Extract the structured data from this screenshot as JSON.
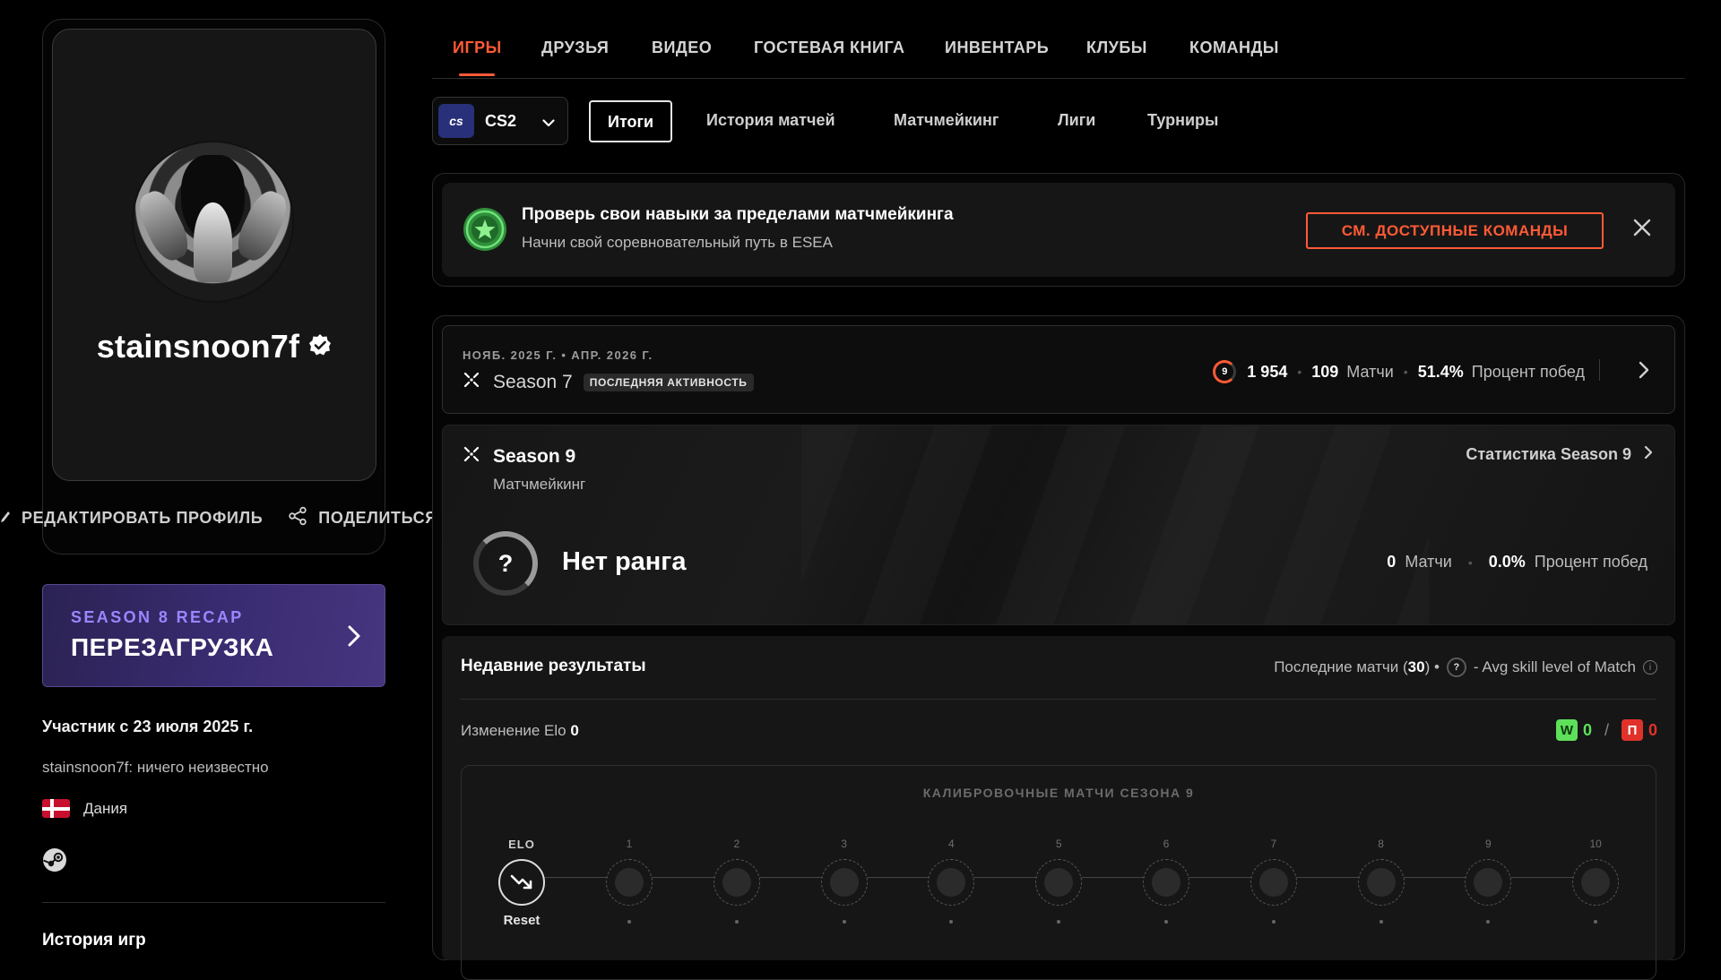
{
  "profile": {
    "username": "stainsnoon7f",
    "edit_label": "РЕДАКТИРОВАТЬ ПРОФИЛЬ",
    "share_label": "ПОДЕЛИТЬСЯ",
    "member_since": "Участник с 23 июля 2025 г.",
    "bio": "stainsnoon7f: ничего неизвестно",
    "country": "Дания",
    "games_history_title": "История игр"
  },
  "recap": {
    "subtitle": "SEASON 8 RECAP",
    "title": "ПЕРЕЗАГРУЗКА"
  },
  "main_tabs": [
    {
      "label": "ИГРЫ",
      "active": true
    },
    {
      "label": "ДРУЗЬЯ"
    },
    {
      "label": "ВИДЕО"
    },
    {
      "label": "ГОСТЕВАЯ КНИГА"
    },
    {
      "label": "ИНВЕНТАРЬ"
    },
    {
      "label": "КЛУБЫ"
    },
    {
      "label": "КОМАНДЫ"
    }
  ],
  "game_selector": {
    "logo_text": "cs",
    "game": "CS2"
  },
  "sub_tabs": [
    {
      "label": "Итоги",
      "active": true
    },
    {
      "label": "История матчей"
    },
    {
      "label": "Матчмейкинг"
    },
    {
      "label": "Лиги"
    },
    {
      "label": "Турниры"
    }
  ],
  "promo": {
    "title": "Проверь свои навыки за пределами матчмейкинга",
    "subtitle": "Начни свой соревновательный путь в ESEA",
    "button": "СМ. ДОСТУПНЫЕ КОМАНДЫ"
  },
  "season7": {
    "dates": "НОЯБ. 2025 Г. • АПР. 2026 Г.",
    "name": "Season 7",
    "badge": "ПОСЛЕДНЯЯ АКТИВНОСТЬ",
    "level": "9",
    "elo": "1 954",
    "matches_value": "109",
    "matches_label": "Матчи",
    "winrate_value": "51.4%",
    "winrate_label": "Процент побед"
  },
  "season9": {
    "name": "Season 9",
    "mode": "Матчмейкинг",
    "stats_link": "Статистика Season 9",
    "rank_symbol": "?",
    "rank_name": "Нет ранга",
    "matches_value": "0",
    "matches_label": "Матчи",
    "winrate_value": "0.0%",
    "winrate_label": "Процент побед"
  },
  "recent": {
    "title": "Недавние результаты",
    "last_matches_prefix": "Последние матчи (",
    "last_matches_count": "30",
    "last_matches_suffix": ") •",
    "avg_skill_label": "- Avg skill level of Match",
    "elo_change_label": "Изменение Elo",
    "elo_change_value": "0",
    "wins_badge": "W",
    "wins": "0",
    "losses_badge": "П",
    "losses": "0",
    "wl_separator": "/"
  },
  "calibration": {
    "title": "КАЛИБРОВОЧНЫЕ МАТЧИ СЕЗОНА 9",
    "elo_label": "ELO",
    "reset_label": "Reset",
    "steps": [
      "1",
      "2",
      "3",
      "4",
      "5",
      "6",
      "7",
      "8",
      "9",
      "10"
    ]
  },
  "colors": {
    "accent": "#ff5a36",
    "win": "#5ee05a",
    "loss": "#e0322a",
    "recap_purple": "#9c86ff"
  },
  "icons": [
    "pencil-icon",
    "share-icon",
    "verified-icon",
    "chevron-right-icon",
    "chevron-down-icon",
    "close-icon",
    "steam-icon",
    "season-icon",
    "star-badge-icon",
    "info-icon",
    "trend-down-icon"
  ]
}
